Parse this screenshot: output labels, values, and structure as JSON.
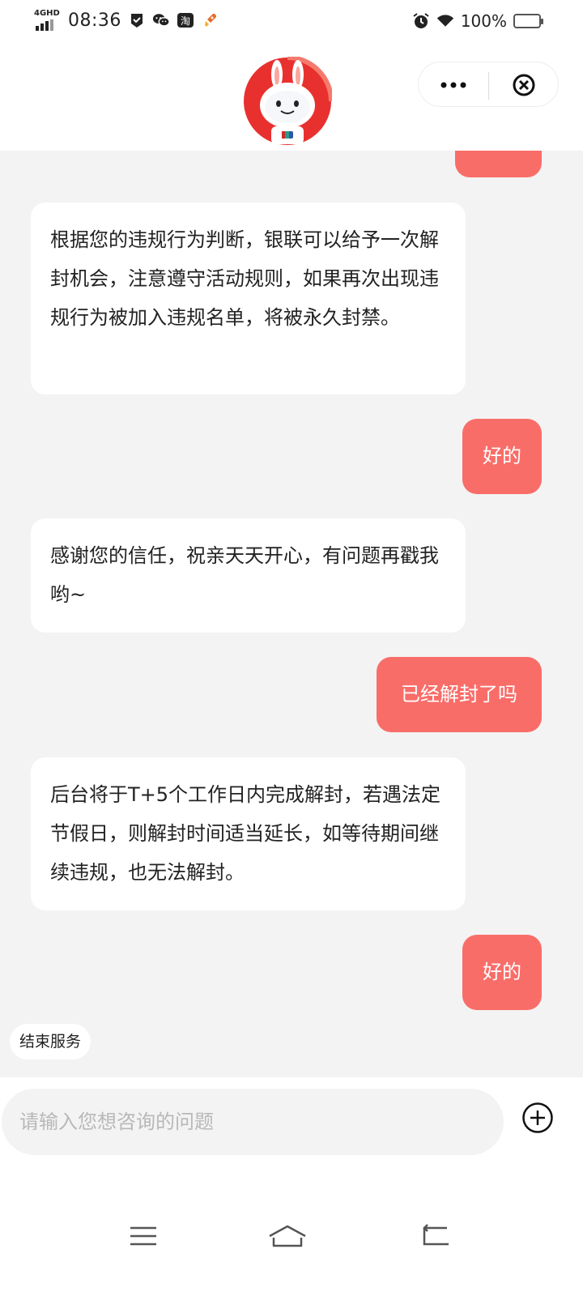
{
  "status_bar": {
    "network": "4GHD",
    "time": "08:36",
    "battery": "100%",
    "battery_level": 1.0
  },
  "header": {
    "more_icon": "more-dots-icon",
    "close_icon": "close-circle-icon"
  },
  "messages": [
    {
      "role": "user",
      "text": ""
    },
    {
      "role": "bot",
      "text": "根据您的违规行为判断，银联可以给予一次解封机会，注意遵守活动规则，如果再次出现违规行为被加入违规名单，将被永久封禁。"
    },
    {
      "role": "user",
      "text": "好的"
    },
    {
      "role": "bot",
      "text": "感谢您的信任，祝亲天天开心，有问题再戳我哟~"
    },
    {
      "role": "user",
      "text": "已经解封了吗"
    },
    {
      "role": "bot",
      "text": "后台将于T+5个工作日内完成解封，若遇法定节假日，则解封时间适当延长，如等待期间继续违规，也无法解封。"
    },
    {
      "role": "user",
      "text": "好的"
    }
  ],
  "end_service_label": "结束服务",
  "input": {
    "placeholder": "请输入您想咨询的问题",
    "value": ""
  },
  "colors": {
    "user_bubble": "#f96d69",
    "chat_background": "#f3f3f3",
    "bot_bubble": "#ffffff"
  }
}
